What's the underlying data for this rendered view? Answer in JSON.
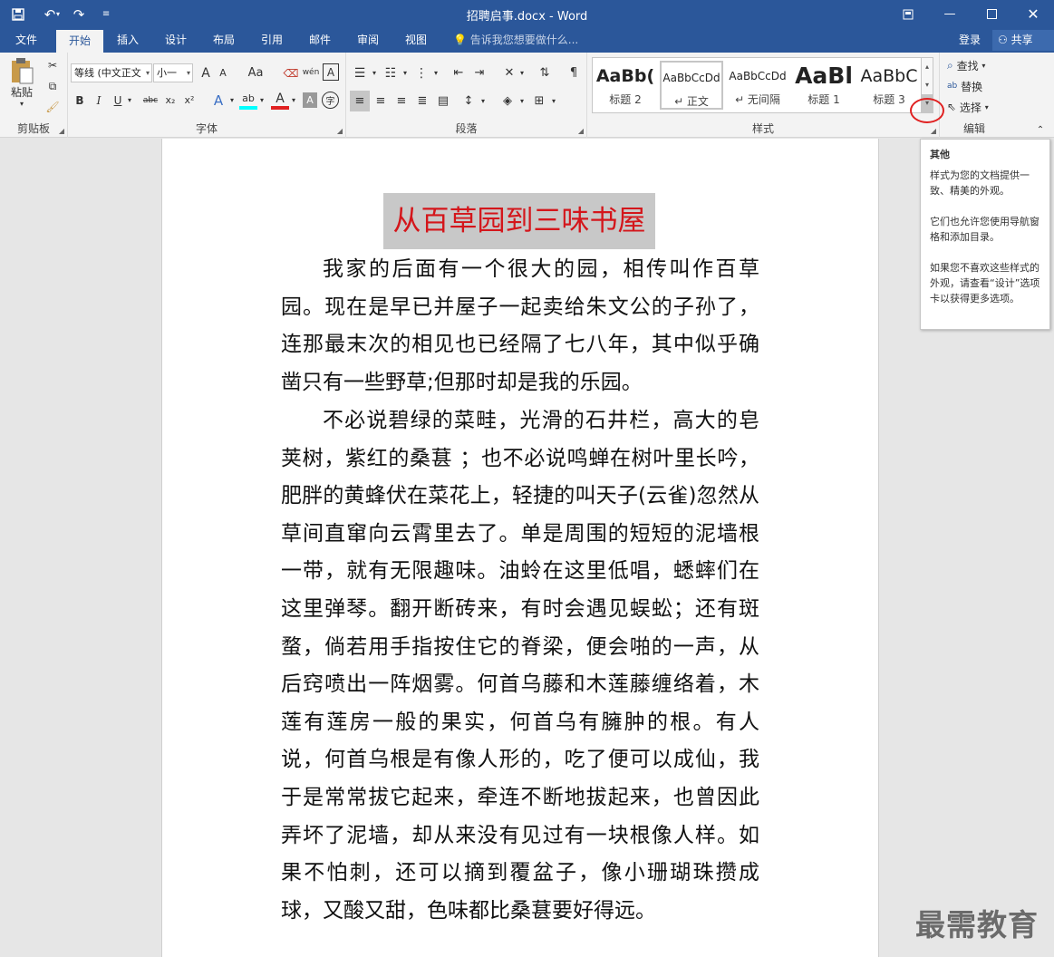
{
  "window": {
    "title": "招聘启事.docx - Word"
  },
  "tabs": [
    "文件",
    "开始",
    "插入",
    "设计",
    "布局",
    "引用",
    "邮件",
    "审阅",
    "视图"
  ],
  "tell_me": "告诉我您想要做什么...",
  "account": {
    "login": "登录",
    "share": "共享"
  },
  "ribbon": {
    "clipboard": {
      "paste": "粘贴",
      "label": "剪贴板"
    },
    "font": {
      "font_name": "等线 (中文正文",
      "font_size": "小一",
      "label": "字体",
      "grow": "A",
      "shrink": "A",
      "change_case": "Aa",
      "pinyin": "wén",
      "border_char": "A",
      "bold": "B",
      "italic": "I",
      "underline": "U",
      "strike": "abc",
      "subscript": "x₂",
      "superscript": "x²",
      "effects": "A",
      "highlight": "ab",
      "font_color": "A",
      "shading": "A",
      "enclose": "字"
    },
    "paragraph": {
      "label": "段落"
    },
    "styles": {
      "label": "样式",
      "items": [
        {
          "preview": "AaBb(",
          "name": "标题 2"
        },
        {
          "preview": "AaBbCcDd",
          "name": "↵ 正文"
        },
        {
          "preview": "AaBbCcDd",
          "name": "↵ 无间隔"
        },
        {
          "preview": "AaBl",
          "name": "标题 1"
        },
        {
          "preview": "AaBbC",
          "name": "标题 3"
        }
      ]
    },
    "editing": {
      "label": "编辑",
      "find": "查找",
      "replace": "替换",
      "select": "选择"
    }
  },
  "tooltip": {
    "title": "其他",
    "p1": "样式为您的文档提供一致、精美的外观。",
    "p2": "它们也允许您使用导航窗格和添加目录。",
    "p3": "如果您不喜欢这些样式的外观，请查看“设计”选项卡以获得更多选项。"
  },
  "document": {
    "title": "从百草园到三味书屋",
    "paragraphs": [
      "我家的后面有一个很大的园，相传叫作百草园。现在是早已并屋子一起卖给朱文公的子孙了，连那最末次的相见也已经隔了七八年，其中似乎确凿只有一些野草;但那时却是我的乐园。",
      "不必说碧绿的菜畦，光滑的石井栏，高大的皂荚树，紫红的桑葚 ；也不必说鸣蝉在树叶里长吟，肥胖的黄蜂伏在菜花上，轻捷的叫天子(云雀)忽然从草间直窜向云霄里去了。单是周围的短短的泥墙根一带，就有无限趣味。油蛉在这里低唱，蟋蟀们在这里弹琴。翻开断砖来，有时会遇见蜈蚣；还有斑蝥，倘若用手指按住它的脊梁，便会啪的一声，从后窍喷出一阵烟雾。何首乌藤和木莲藤缠络着，木莲有莲房一般的果实，何首乌有臃肿的根。有人说，何首乌根是有像人形的，吃了便可以成仙，我于是常常拔它起来，牵连不断地拔起来，也曾因此弄坏了泥墙，却从来没有见过有一块根像人样。如果不怕刺，还可以摘到覆盆子，像小珊瑚珠攒成球，又酸又甜，色味都比桑葚要好得远。"
    ]
  },
  "watermark": "最需教育",
  "colors": {
    "accent": "#2b579a",
    "title_red": "#d4161b",
    "highlight_circle": "#e02020"
  }
}
